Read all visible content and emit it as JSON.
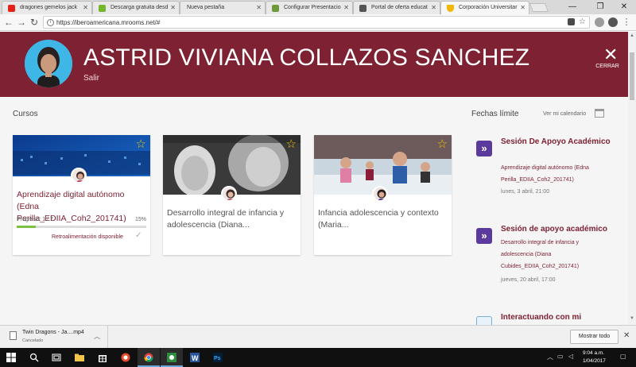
{
  "browser": {
    "tabs": [
      {
        "title": "dragones gemelos jack",
        "favicon_color": "#e62117",
        "active": false
      },
      {
        "title": "Descarga gratuita desd",
        "favicon_color": "#77b52f",
        "active": false
      },
      {
        "title": "Nueva pestaña",
        "favicon_color": "",
        "active": false
      },
      {
        "title": "Configurar Presentacio",
        "favicon_color": "#6d9b3a",
        "active": false
      },
      {
        "title": "Portal de oferta educat",
        "favicon_color": "#555555",
        "active": false
      },
      {
        "title": "Corporación Universitar",
        "favicon_color": "#f2b705",
        "active": true
      }
    ],
    "url": "https://iberoamericana.mrooms.net/#"
  },
  "header": {
    "user_name": "ASTRID VIVIANA COLLAZOS SANCHEZ",
    "logout_label": "Salir",
    "close_label": "CERRAR",
    "background_color": "#7e2233"
  },
  "courses": {
    "section_title": "Cursos",
    "cards": [
      {
        "title": "Aprendizaje digital autónomo (Edna Perilla_EDIIA_Coh2_201741)",
        "progress_label": "Progreso: 1 / 7",
        "progress_percent_label": "15%",
        "progress_fraction": 0.15,
        "feedback_label": "Retroalimentación disponible"
      },
      {
        "title": "Desarrollo integral de infancia y adolescencia (Diana..."
      },
      {
        "title": "Infancia adolescencia y contexto (Maria..."
      }
    ]
  },
  "deadlines": {
    "section_title": "Fechas límite",
    "calendar_link": "Ver mi calendario",
    "events": [
      {
        "title": "Sesión De Apoyo Académico",
        "course": "Aprendizaje digital autónomo (Edna Perilla_EDIIA_Coh2_201741)",
        "date": "lunes, 3 abril, 21:00"
      },
      {
        "title": "Sesión de apoyo académico",
        "course": "Desarrollo integral de infancia y adolescencia (Diana Cubides_EDIIA_Coh2_201741)",
        "date": "jueves, 20 abril, 17:00"
      },
      {
        "title": "Interactuando con mi"
      }
    ]
  },
  "downloads": {
    "file_name": "Twin Dragons - Ja....mp4",
    "status": "Cancelado",
    "show_all_label": "Mostrar todo"
  },
  "taskbar": {
    "time": "9:04 a.m.",
    "date": "1/04/2017"
  }
}
